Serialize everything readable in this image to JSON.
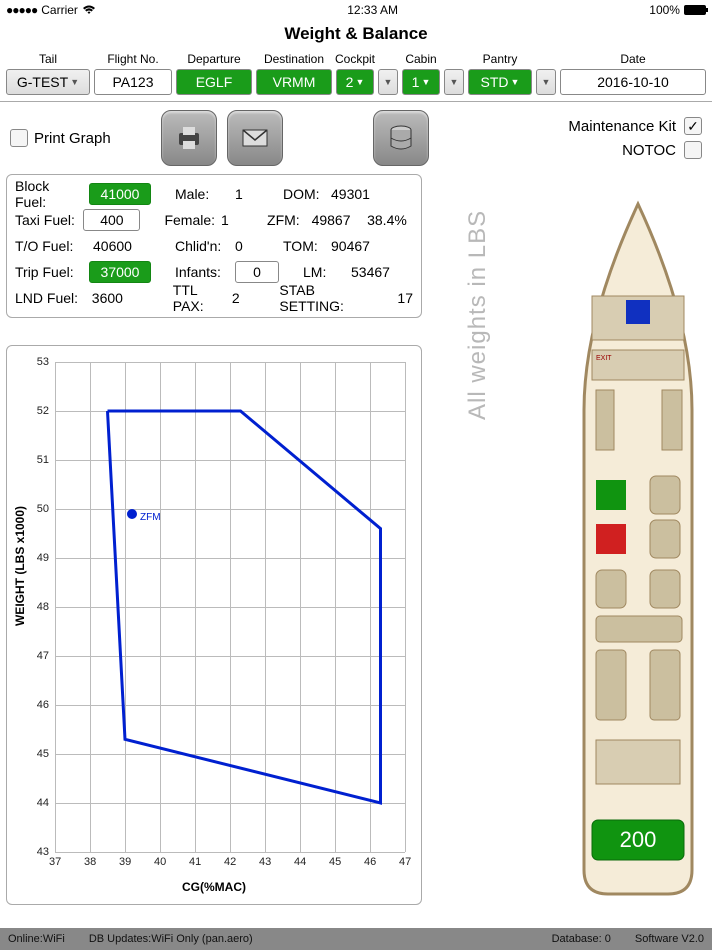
{
  "status": {
    "carrier": "Carrier",
    "time": "12:33 AM",
    "battery": "100%"
  },
  "title": "Weight & Balance",
  "config": {
    "tail": {
      "label": "Tail",
      "value": "G-TEST"
    },
    "flight": {
      "label": "Flight No.",
      "value": "PA123"
    },
    "dep": {
      "label": "Departure",
      "value": "EGLF"
    },
    "dest": {
      "label": "Destination",
      "value": "VRMM"
    },
    "cockpit": {
      "label": "Cockpit",
      "value": "2"
    },
    "cabin": {
      "label": "Cabin",
      "value": "1"
    },
    "pantry": {
      "label": "Pantry",
      "value": "STD"
    },
    "date": {
      "label": "Date",
      "value": "2016-10-10"
    }
  },
  "tools": {
    "printLabel": "Print Graph",
    "maintKit": "Maintenance Kit",
    "notoc": "NOTOC"
  },
  "fuel": {
    "block": {
      "lbl": "Block Fuel:",
      "val": "41000"
    },
    "taxi": {
      "lbl": "Taxi Fuel:",
      "val": "400"
    },
    "to": {
      "lbl": "T/O Fuel:",
      "val": "40600"
    },
    "trip": {
      "lbl": "Trip Fuel:",
      "val": "37000"
    },
    "lnd": {
      "lbl": "LND Fuel:",
      "val": "3600"
    },
    "male": {
      "lbl": "Male:",
      "val": "1"
    },
    "female": {
      "lbl": "Female:",
      "val": "1"
    },
    "child": {
      "lbl": "Chlid'n:",
      "val": "0"
    },
    "infant": {
      "lbl": "Infants:",
      "val": "0"
    },
    "ttlpax": {
      "lbl": "TTL PAX:",
      "val": "2"
    },
    "dom": {
      "lbl": "DOM:",
      "val": "49301"
    },
    "zfm": {
      "lbl": "ZFM:",
      "val": "49867",
      "pct": "38.4%"
    },
    "tom": {
      "lbl": "TOM:",
      "val": "90467"
    },
    "lm": {
      "lbl": "LM:",
      "val": "53467"
    },
    "stab": {
      "lbl": "STAB SETTING:",
      "val": "17"
    }
  },
  "chart_data": {
    "type": "line",
    "title": "",
    "xlabel": "CG(%MAC)",
    "ylabel": "WEIGHT (LBS x1000)",
    "xlim": [
      37,
      47
    ],
    "ylim": [
      43,
      53
    ],
    "envelope": [
      {
        "x": 38.5,
        "y": 52.0
      },
      {
        "x": 42.3,
        "y": 52.0
      },
      {
        "x": 46.3,
        "y": 49.6
      },
      {
        "x": 46.3,
        "y": 44.0
      },
      {
        "x": 39.0,
        "y": 45.3
      },
      {
        "x": 38.5,
        "y": 52.0
      }
    ],
    "points": [
      {
        "label": "ZFM",
        "x": 39.2,
        "y": 49.9
      }
    ]
  },
  "weights_tag": "All weights in LBS",
  "plane": {
    "aft_value": "200"
  },
  "footer": {
    "online": "Online:WiFi",
    "db": "DB Updates:WiFi Only   (pan.aero)",
    "database": "Database:  0",
    "sw": "Software V2.0"
  }
}
